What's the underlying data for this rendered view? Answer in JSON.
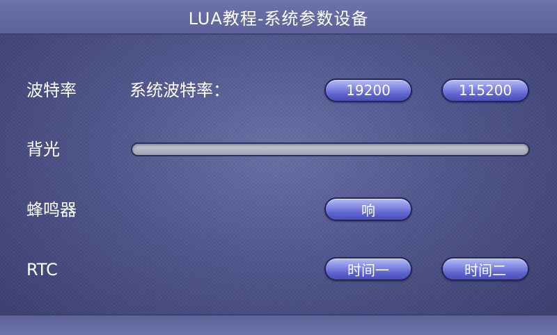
{
  "window": {
    "title": "LUA教程-系统参数设备"
  },
  "baud": {
    "label": "波特率",
    "sub_label": "系统波特率：",
    "options": [
      "19200",
      "115200"
    ]
  },
  "backlight": {
    "label": "背光",
    "level_percent": 0
  },
  "buzzer": {
    "label": "蜂鸣器",
    "button_label": "响"
  },
  "rtc": {
    "label": "RTC",
    "buttons": [
      "时间一",
      "时间二"
    ]
  },
  "colors": {
    "background": "#50558c",
    "title_bar": "#6d72aa",
    "button_fill": "#6a6fd8",
    "button_border": "#23265a",
    "text": "#ffffff"
  }
}
